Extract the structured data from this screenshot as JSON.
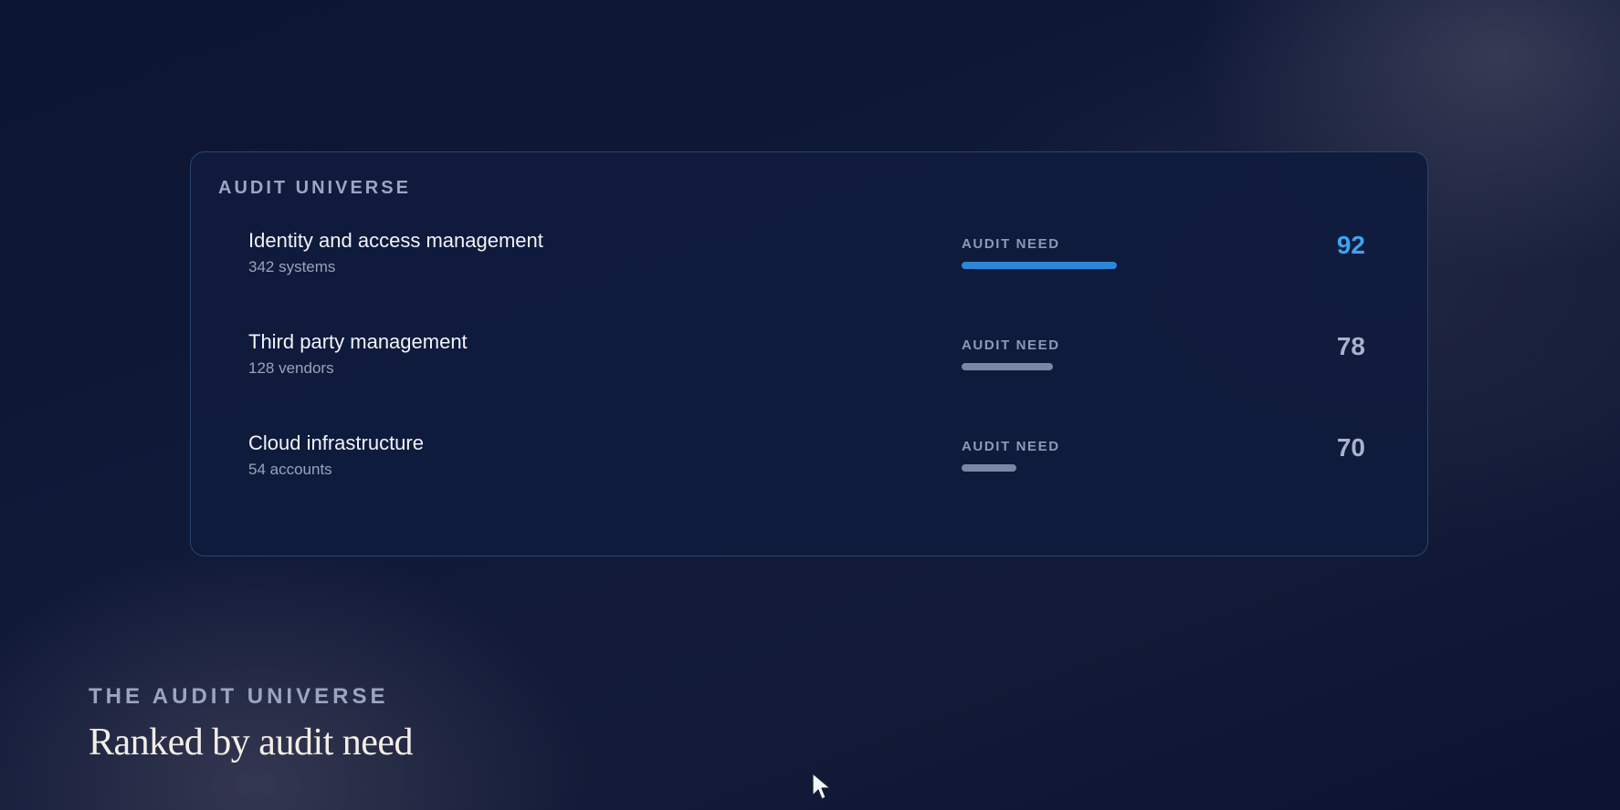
{
  "panel": {
    "title": "AUDIT UNIVERSE",
    "rows": [
      {
        "name": "Identity and access management",
        "sub": "342 systems",
        "need_label": "AUDIT NEED",
        "score": "92",
        "need_level": 0.92,
        "highlight": true
      },
      {
        "name": "Third party management",
        "sub": "128 vendors",
        "need_label": "AUDIT NEED",
        "score": "78",
        "need_level": 0.78,
        "highlight": false
      },
      {
        "name": "Cloud infrastructure",
        "sub": "54 accounts",
        "need_label": "AUDIT NEED",
        "score": "70",
        "need_level": 0.7,
        "highlight": false
      }
    ]
  },
  "footer": {
    "eyebrow": "THE AUDIT UNIVERSE",
    "heading": "Ranked by audit need"
  },
  "colors": {
    "highlight_bar": "#2f86d6",
    "highlight_score": "#3ea3ef",
    "muted_bar": "#7c87a6",
    "muted_score": "#aab3cb"
  },
  "icons": {
    "cursor": "cursor-arrow-icon"
  }
}
